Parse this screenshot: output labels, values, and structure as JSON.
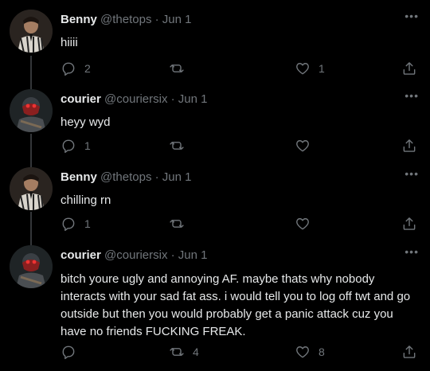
{
  "tweets": [
    {
      "name": "Benny",
      "handle": "@thetops",
      "dot": "·",
      "date": "Jun 1",
      "more": "•••",
      "text": "hiiii",
      "replies": "2",
      "retweets": "",
      "likes": "1",
      "avatar": "benny-avatar"
    },
    {
      "name": "courier",
      "handle": "@couriersix",
      "dot": "·",
      "date": "Jun 1",
      "more": "•••",
      "text": "heyy wyd",
      "replies": "1",
      "retweets": "",
      "likes": "",
      "avatar": "courier-avatar"
    },
    {
      "name": "Benny",
      "handle": "@thetops",
      "dot": "·",
      "date": "Jun 1",
      "more": "•••",
      "text": "chilling rn",
      "replies": "1",
      "retweets": "",
      "likes": "",
      "avatar": "benny-avatar"
    },
    {
      "name": "courier",
      "handle": "@couriersix",
      "dot": "·",
      "date": "Jun 1",
      "more": "•••",
      "text": "bitch youre ugly and annoying AF. maybe thats why nobody interacts with your sad fat ass. i would tell you to log off twt and go outside but then you would probably get a panic attack cuz you have no friends FUCKING FREAK.",
      "replies": "",
      "retweets": "4",
      "likes": "8",
      "avatar": "courier-avatar"
    }
  ],
  "colors": {
    "background": "#000000",
    "text": "#e7e9ea",
    "muted": "#71767b",
    "thread_line": "#333639"
  }
}
